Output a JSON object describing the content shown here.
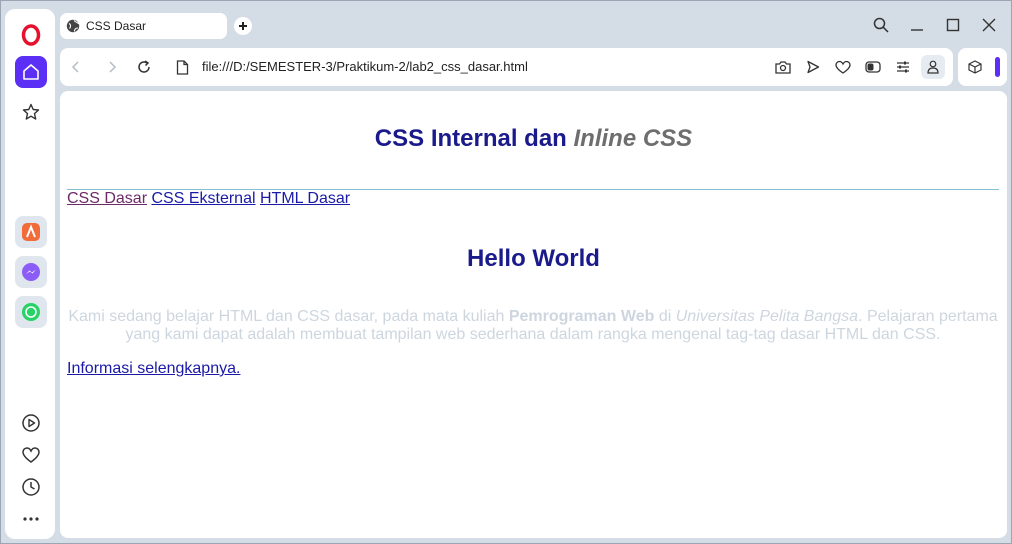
{
  "browser": {
    "tab_title": "CSS Dasar",
    "url": "file:///D:/SEMESTER-3/Praktikum-2/lab2_css_dasar.html"
  },
  "sidebar": {
    "items": [
      "opera-logo-icon",
      "home-icon",
      "star-icon",
      "aria-icon",
      "messenger-icon",
      "whatsapp-icon",
      "player-icon",
      "heart-icon",
      "history-icon",
      "more-icon"
    ]
  },
  "page": {
    "h1_prefix": "CSS Internal dan ",
    "h1_inline": "Inline CSS",
    "nav": [
      "CSS Dasar",
      "CSS Eksternal",
      "HTML Dasar"
    ],
    "h2": "Hello World",
    "para_1": "Kami sedang belajar HTML dan CSS dasar, pada mata kuliah ",
    "para_bold": "Pemrograman Web",
    "para_2": " di ",
    "para_italic": "Universitas Pelita Bangsa",
    "para_3": ". Pelajaran pertama yang kami dapat adalah membuat tampilan web sederhana dalam rangka mengenal tag-tag dasar HTML dan CSS.",
    "more_link": "Informasi selengkapnya."
  },
  "colors": {
    "accent": "#5b2ff5",
    "heading": "#1a1a8c",
    "link": "#1a1aa6",
    "visited_link": "#6d2a66",
    "paragraph": "#cdd6df"
  }
}
